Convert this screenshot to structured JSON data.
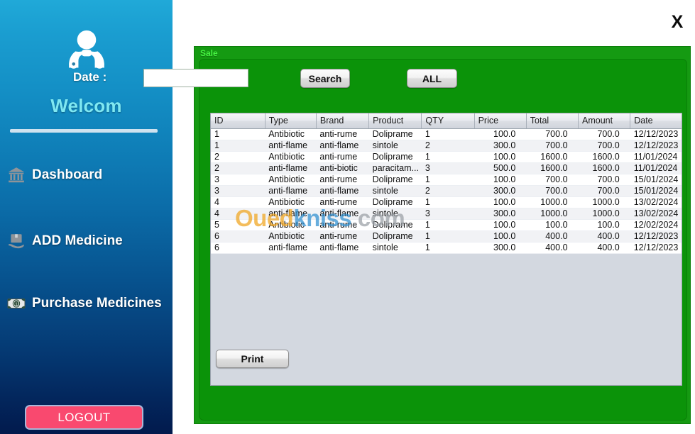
{
  "window": {
    "close_label": "X"
  },
  "sidebar": {
    "welcome_title": "Welcom",
    "brand_icon": "doctor-stethoscope-icon",
    "items": [
      {
        "label": "Dashboard",
        "icon": "bank-building-icon"
      },
      {
        "label": "ADD Medicine",
        "icon": "package-delivery-icon"
      },
      {
        "label": "Purchase Medicines",
        "icon": "banknote-icon"
      }
    ],
    "logout_label": "LOGOUT",
    "logout_color": "#f9496f",
    "accent_top": "#20a9d8",
    "accent_bottom": "#021a4d",
    "title_color": "#7fe8f2"
  },
  "panel": {
    "title": "Sale",
    "title_color": "#46f642",
    "background": "#0b9309",
    "date_label": "Date :",
    "date_value": "",
    "date_placeholder": "",
    "search_label": "Search",
    "all_label": "ALL",
    "print_label": "Print"
  },
  "table": {
    "columns": [
      "ID",
      "Type",
      "Brand",
      "Product",
      "QTY",
      "Price",
      "Total",
      "Amount",
      "Date"
    ],
    "rows": [
      [
        "1",
        "Antibiotic",
        "anti-rume",
        "Doliprame",
        "1",
        "100.0",
        "700.0",
        "700.0",
        "12/12/2023"
      ],
      [
        "1",
        "anti-flame",
        "anti-flame",
        "sintole",
        "2",
        "300.0",
        "700.0",
        "700.0",
        "12/12/2023"
      ],
      [
        "2",
        "Antibiotic",
        "anti-rume",
        "Doliprame",
        "1",
        "100.0",
        "1600.0",
        "1600.0",
        "11/01/2024"
      ],
      [
        "2",
        "anti-flame",
        "anti-biotic",
        "paracitam...",
        "3",
        "500.0",
        "1600.0",
        "1600.0",
        "11/01/2024"
      ],
      [
        "3",
        "Antibiotic",
        "anti-rume",
        "Doliprame",
        "1",
        "100.0",
        "700.0",
        "700.0",
        "15/01/2024"
      ],
      [
        "3",
        "anti-flame",
        "anti-flame",
        "sintole",
        "2",
        "300.0",
        "700.0",
        "700.0",
        "15/01/2024"
      ],
      [
        "4",
        "Antibiotic",
        "anti-rume",
        "Doliprame",
        "1",
        "100.0",
        "1000.0",
        "1000.0",
        "13/02/2024"
      ],
      [
        "4",
        "anti-flame",
        "anti-flame",
        "sintole",
        "3",
        "300.0",
        "1000.0",
        "1000.0",
        "13/02/2024"
      ],
      [
        "5",
        "Antibiotic",
        "anti-rume",
        "Doliprame",
        "1",
        "100.0",
        "100.0",
        "100.0",
        "12/02/2024"
      ],
      [
        "6",
        "Antibiotic",
        "anti-rume",
        "Doliprame",
        "1",
        "100.0",
        "400.0",
        "400.0",
        "12/12/2023"
      ],
      [
        "6",
        "anti-flame",
        "anti-flame",
        "sintole",
        "1",
        "300.0",
        "400.0",
        "400.0",
        "12/12/2023"
      ]
    ]
  },
  "watermark": {
    "part_a": "Oued",
    "part_b": "kniss",
    "part_c": ".com",
    "color_a": "#f0a51e",
    "color_b": "#2f8fd0",
    "color_c": "#9aa0a6"
  }
}
